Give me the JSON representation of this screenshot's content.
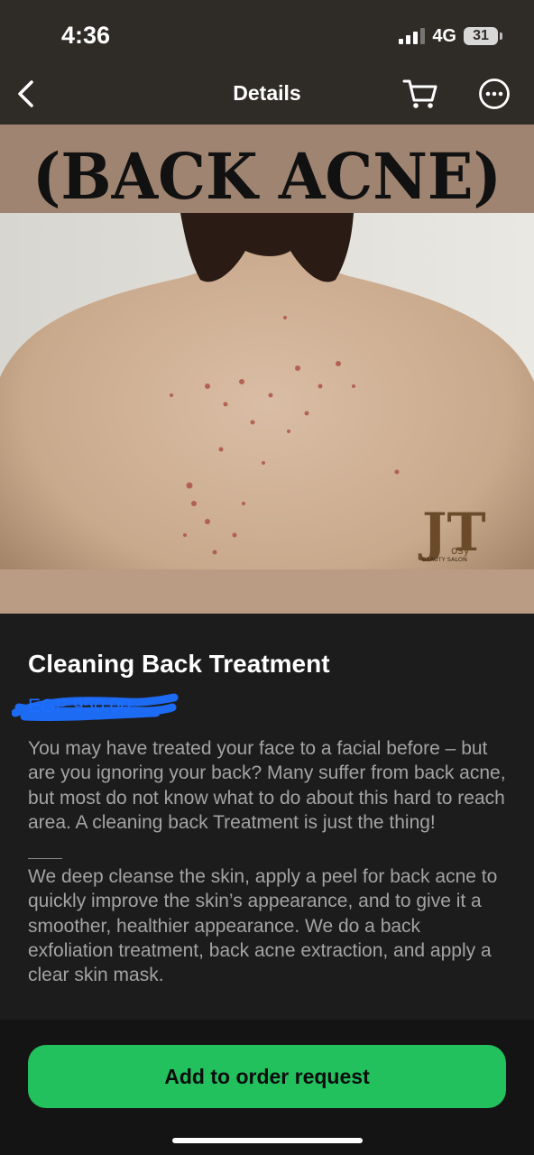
{
  "status_bar": {
    "time": "4:36",
    "network": "4G",
    "battery": "31"
  },
  "nav": {
    "title": "Details",
    "back_icon": "chevron-left-icon",
    "cart_icon": "cart-icon",
    "more_icon": "more-horizontal-icon"
  },
  "hero": {
    "banner_text": "(BACK ACNE)",
    "logo_initials": "JT",
    "logo_script": "osy",
    "logo_caption": "BEAUTY SALON"
  },
  "product": {
    "title": "Cleaning Back Treatment",
    "price": "EGP 950.00",
    "description_1": "You may have treated your face to a facial before – but are you ignoring your back? Many suffer from back acne, but most do not know what to do about this hard to reach area. A cleaning back Treatment is just the thing!",
    "description_2": "We deep cleanse the skin, apply a peel for back acne to quickly improve the skin’s appearance, and to give it a smoother, healthier appearance. We do a back exfoliation treatment, back acne extraction, and apply a clear skin mask."
  },
  "footer": {
    "order_button_label": "Add to order request"
  },
  "colors": {
    "background": "#1c1c1c",
    "header": "#2f2b27",
    "accent_button": "#22c15e",
    "price_scribble": "#1e6fff",
    "banner": "#a08472"
  }
}
